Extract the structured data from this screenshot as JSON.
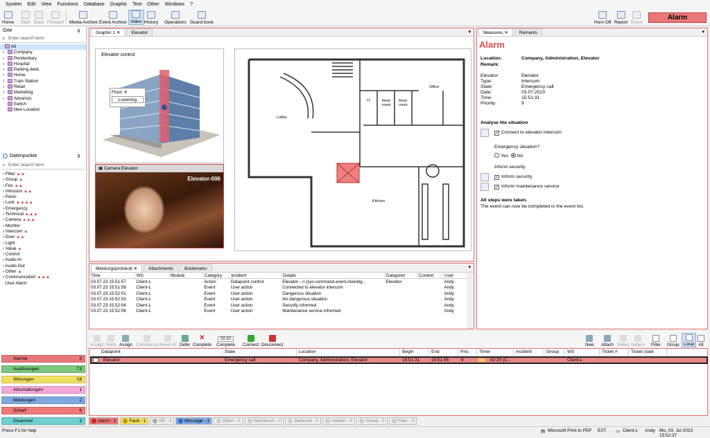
{
  "menu": [
    "System",
    "Edit",
    "View",
    "Functions",
    "Database",
    "Graphic",
    "Text",
    "Other",
    "Windows",
    "?"
  ],
  "toolbar": {
    "home": "Home",
    "start": "Start",
    "back": "Back",
    "forward": "Forward",
    "media": "Media Archive",
    "event": "Event Archive",
    "video": "Video",
    "history": "History",
    "operations": "Operations",
    "guardbook": "Guard book",
    "hornoff": "Horn Off",
    "report": "Report",
    "evt": "Event",
    "alarm": "Alarm"
  },
  "orte": {
    "title": "Orte",
    "placeholder": "Enter search term",
    "items": [
      "All",
      "Company",
      "Penitentiary",
      "Hospital",
      "Parking deck",
      "Home",
      "Train Station",
      "Retail",
      "Marketing",
      "Advancis",
      "Switch",
      "New Location"
    ]
  },
  "dp": {
    "title": "Datenpunkte",
    "placeholder": "Enter search term",
    "items": [
      "Filter",
      "Group",
      "Fire",
      "Intrusion",
      "Panic",
      "Lock",
      "Emergency",
      "Technical",
      "Camera",
      "Monitor",
      "Intercom",
      "Door",
      "Light",
      "Value",
      "Control",
      "Audio-In",
      "Audio-Out",
      "Other",
      "Communication",
      "User Alarm"
    ]
  },
  "categories": [
    {
      "label": "Alarme",
      "count": "3",
      "color": "#e87878"
    },
    {
      "label": "Auslösungen",
      "count": "73",
      "color": "#7cc87c"
    },
    {
      "label": "Störungen",
      "count": "18",
      "color": "#f0e060"
    },
    {
      "label": "Abschaltungen",
      "count": "1",
      "color": "#f5a8d8"
    },
    {
      "label": "Meldungen",
      "count": "2",
      "color": "#80a8e0"
    },
    {
      "label": "Scharf",
      "count": "6",
      "color": "#f07878"
    },
    {
      "label": "Disarmed",
      "count": "3",
      "color": "#70d0d0"
    }
  ],
  "center": {
    "tab1": "Graphic 1",
    "tab2": "Elevator",
    "elevator_title": "Elevator control",
    "floor_label": "Floor:",
    "floor_value": "6",
    "floor_status": "Lowering",
    "camera_title": "Camera Elevator",
    "camera_overlay": "Elevator-006",
    "rooms": {
      "lobby": "Lobby",
      "it": "IT",
      "rest1": "Rest-\nroom",
      "rest2": "Rest-\nroom",
      "office": "Office",
      "kitchen": "Kitchen"
    }
  },
  "right": {
    "tab1": "Measures",
    "tab2": "Remarks",
    "heading": "Alarm",
    "location_label": "Location:",
    "location_value": "Company, Administration, Elevator",
    "remark_label": "Remark:",
    "fields": [
      [
        "Elevator:",
        "Elevator"
      ],
      [
        "Type:",
        "Intercom"
      ],
      [
        "State:",
        "Emergency call"
      ],
      [
        "Date:",
        "03.07.2023"
      ],
      [
        "Time:",
        "15:51:31"
      ],
      [
        "Priority:",
        "9"
      ]
    ],
    "analyse": "Analyse the situation",
    "connect": "Connect to elevator intercom",
    "question": "Emergency situation?",
    "yes": "Yes",
    "no": "No",
    "inform": "Inform security",
    "inform_security": "Inform security",
    "inform_maint": "Inform maintenance service",
    "done": "All steps were taken.",
    "done_sub": "The event can now be completed in the event list."
  },
  "log": {
    "tabs": [
      "Meldungsprotokoll",
      "Attachments",
      "Bookmarks"
    ],
    "headers": [
      "Time",
      "WS",
      "Module",
      "Category",
      "Incident",
      "Details",
      "Datapoint",
      "Context",
      "User"
    ],
    "rows": [
      [
        "03.07.23 15:51:57",
        "Client-L",
        "",
        "Action",
        "Datapoint control",
        "Elevator --> [sys.command.event.investig...",
        "Elevator",
        "",
        "Andy"
      ],
      [
        "03.07.23 15:51:59",
        "Client-L",
        "",
        "Event",
        "User action",
        "Connected to elevator intercom",
        "",
        "",
        "Andy"
      ],
      [
        "03.07.23 15:52:01",
        "Client-L",
        "",
        "Event",
        "User action",
        "Dangerous situation",
        "",
        "",
        "Andy"
      ],
      [
        "03.07.23 15:52:03",
        "Client-L",
        "",
        "Event",
        "User action",
        "No dangerous situation",
        "",
        "",
        "Andy"
      ],
      [
        "03.07.23 15:52:04",
        "Client-L",
        "",
        "Event",
        "User action",
        "Security informed",
        "",
        "",
        "Andy"
      ],
      [
        "03.07.23 15:52:06",
        "Client-L",
        "",
        "Event",
        "User action",
        "Maintenance service informed",
        "",
        "",
        "Andy"
      ]
    ]
  },
  "ops": {
    "accept": "Accept",
    "fetch": "Fetch",
    "assign": "Assign",
    "commands": "Commands",
    "resetall": "Reset All",
    "defer": "Defer",
    "complete": "Complete",
    "timer": "02:20",
    "complete2": "Complete",
    "connect": "Connect",
    "disconnect": "Disconnect",
    "new": "New",
    "attach": "Attach",
    "select": "Select",
    "detach": "Detach",
    "filter": "Filter",
    "group": "Group",
    "local": "Local",
    "all": "All"
  },
  "grid": {
    "headers": [
      "Datapoint",
      "State",
      "Location",
      "Begin",
      "End",
      "Prio.",
      "Timer",
      "Incident",
      "Group",
      "WS",
      "Ticket #",
      "Ticket state"
    ],
    "row": {
      "datapoint": "Elevator",
      "state": "Emergency call",
      "location": "Company, Administration, Elevator",
      "begin": "15:51:31",
      "end": "15:51:55",
      "prio": "9",
      "timer": "02:20 (C...",
      "ws": "Client-L"
    }
  },
  "filters": [
    "Alarm - 1",
    "Fault - 1",
    "Off - 0",
    "Message - 1",
    "Other - 0",
    "Wachbuch - 0",
    "Deferred - 0",
    "Hidden - 0",
    "Group - 0",
    "Filter - 0"
  ],
  "status": {
    "help": "Press F1 for help",
    "printer": "Microsoft Print to PDF",
    "ext": "EXT",
    "client": "Client-L",
    "user": "Andy",
    "datetime": "Mo, 03. Jul 2023   15:52:37"
  }
}
